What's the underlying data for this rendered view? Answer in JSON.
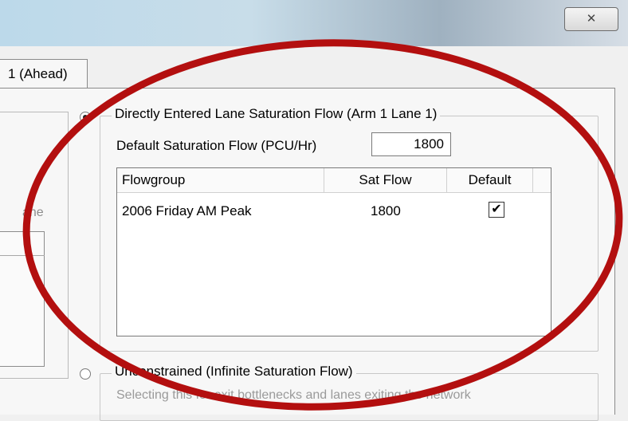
{
  "window": {
    "close_glyph": "✕"
  },
  "tab": {
    "label": "1 (Ahead)"
  },
  "left_panel": {
    "fragment": "ane"
  },
  "direct_option": {
    "legend": "Directly Entered Lane Saturation Flow (Arm 1 Lane 1)",
    "selected": true,
    "default_flow_label": "Default Saturation Flow (PCU/Hr)",
    "default_flow_value": "1800"
  },
  "flow_table": {
    "columns": [
      "Flowgroup",
      "Sat Flow",
      "Default"
    ],
    "rows": [
      {
        "flowgroup": "2006 Friday AM Peak",
        "sat_flow": "1800",
        "default_checked": true,
        "check_glyph": "✔"
      }
    ]
  },
  "unconstrained_option": {
    "legend": "Unconstrained (Infinite Saturation Flow)",
    "selected": false,
    "hint": "Selecting this for exit bottlenecks and lanes exiting the network"
  },
  "annotation": {
    "ellipse_color": "#b30f0f"
  }
}
